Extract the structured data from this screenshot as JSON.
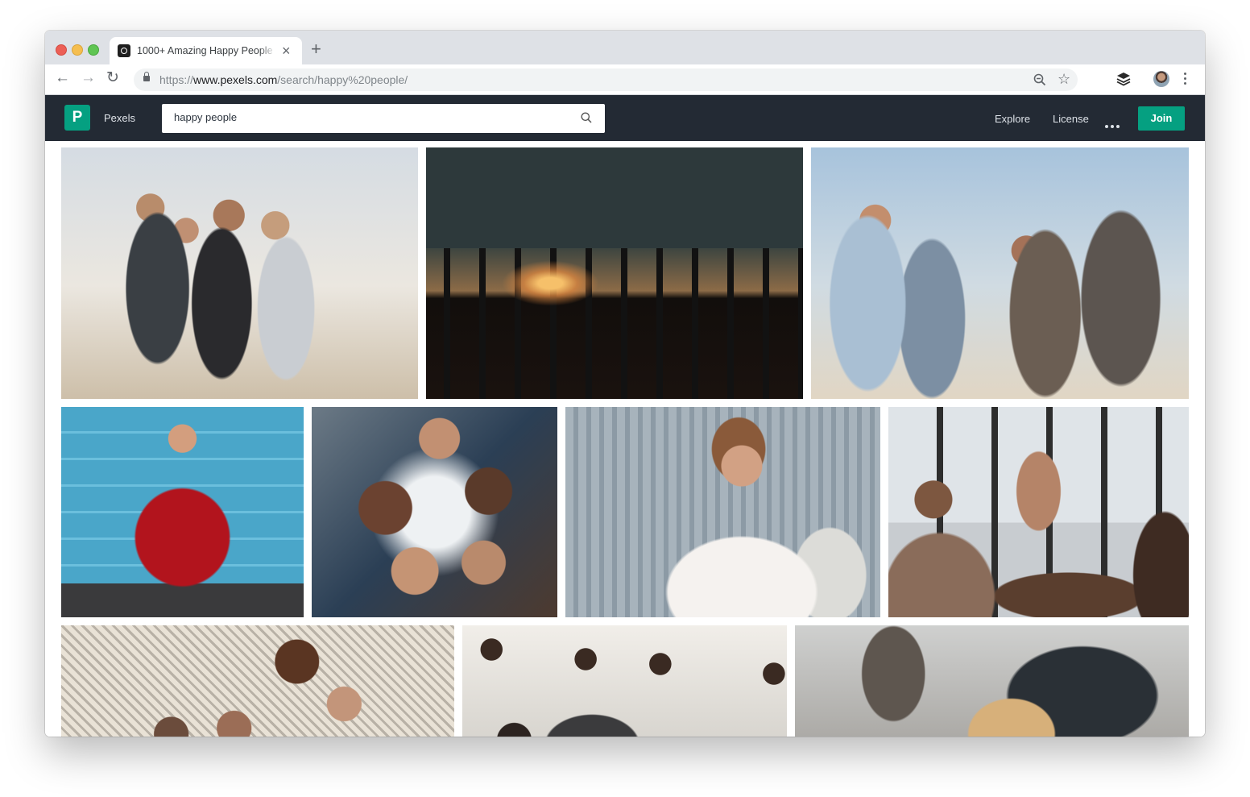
{
  "browser": {
    "tab": {
      "title": "1000+ Amazing Happy People",
      "favicon": "camera-icon"
    },
    "url": {
      "scheme": "https://",
      "host": "www.pexels.com",
      "path": "/search/happy%20people/"
    }
  },
  "site": {
    "brand": "Pexels",
    "logo_mark": "P",
    "search": {
      "value": "happy people"
    },
    "nav": [
      "Explore",
      "License"
    ],
    "join_label": "Join",
    "colors": {
      "header_bg": "#232a34",
      "accent": "#05a081"
    }
  },
  "photos": [
    {
      "alt": "four friends laughing outdoors"
    },
    {
      "alt": "silhouettes of people jumping at sunset"
    },
    {
      "alt": "group of friends laughing in sunlight"
    },
    {
      "alt": "man in red sweater cheering against blue wall"
    },
    {
      "alt": "circle of people looking down at camera"
    },
    {
      "alt": "woman smiling on phone holding tablet"
    },
    {
      "alt": "coworkers giving high five at office table"
    },
    {
      "alt": "friends smiling together"
    },
    {
      "alt": "people raising fists in celebration"
    },
    {
      "alt": "people working in office with monitor"
    }
  ]
}
